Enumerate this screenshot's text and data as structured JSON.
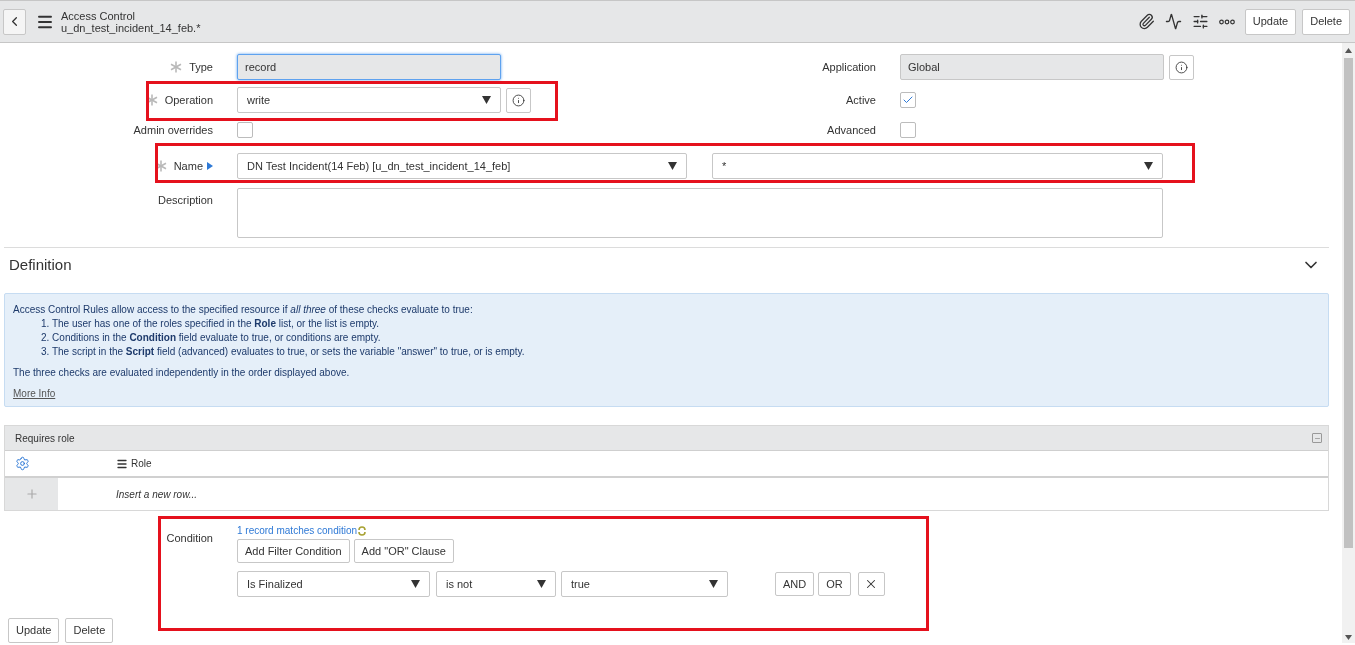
{
  "header": {
    "title": "Access Control",
    "subtitle": "u_dn_test_incident_14_feb.*",
    "buttons": [
      "Update",
      "Delete"
    ]
  },
  "fields_left": [
    {
      "kind": "input",
      "label": "Type",
      "required": true,
      "value": "record",
      "focused": true,
      "info": false
    },
    {
      "kind": "select",
      "label": "Operation",
      "required": true,
      "value": "write",
      "info": true
    },
    {
      "kind": "checkbox",
      "label": "Admin overrides",
      "required": false,
      "checked": false
    }
  ],
  "fields_right": [
    {
      "kind": "input",
      "label": "Application",
      "value": "Global",
      "focused": false,
      "info": true
    },
    {
      "kind": "checkbox",
      "label": "Active",
      "checked": true
    },
    {
      "kind": "checkbox",
      "label": "Advanced",
      "checked": false
    }
  ],
  "name_field": {
    "label": "Name",
    "required": true,
    "table": "DN Test Incident(14 Feb) [u_dn_test_incident_14_feb]",
    "column": "*"
  },
  "description": {
    "label": "Description"
  },
  "definition": {
    "title": "Definition"
  },
  "info": {
    "intro": "Access Control Rules allow access to the specified resource if *all three* of these checks evaluate to true:",
    "items": [
      "1. The user has one of the roles specified in the **Role** list, or the list is empty.",
      "2. Conditions in the **Condition** field evaluate to true, or conditions are empty.",
      "3. The script in the **Script** field (advanced) evaluates to true, or sets the variable \"answer\" to true, or is empty."
    ],
    "note": "The three checks are evaluated independently in the order displayed above.",
    "link": "More Info"
  },
  "related_list": {
    "title": "Requires role",
    "column": "Role",
    "insert_placeholder": "Insert a new row..."
  },
  "condition": {
    "label": "Condition",
    "matches": "1 record matches condition",
    "buttons": [
      "Add Filter Condition",
      "Add \"OR\" Clause"
    ],
    "field": "Is Finalized",
    "operator": "is not",
    "value": "true",
    "joins": [
      "AND",
      "OR"
    ]
  },
  "footer_buttons": [
    "Update",
    "Delete"
  ]
}
